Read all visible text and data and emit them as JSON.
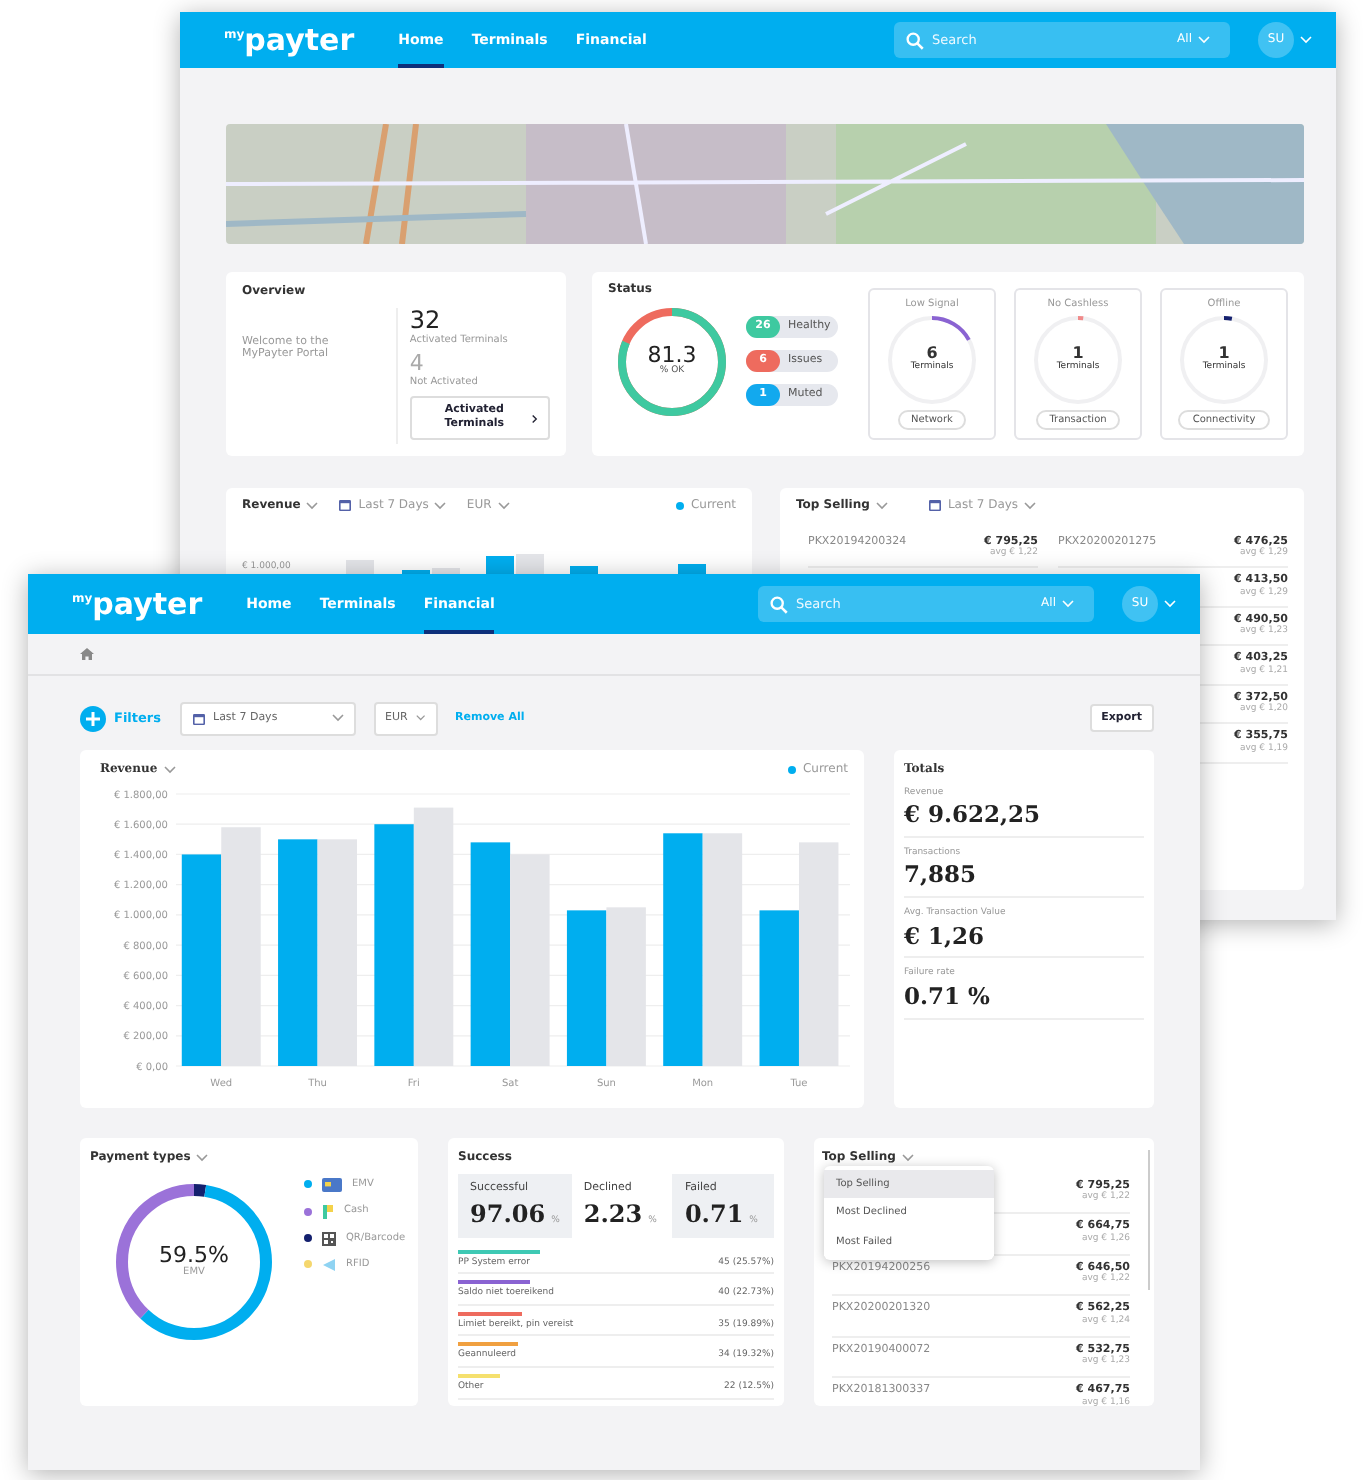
{
  "back_window": {
    "navbar": {
      "logo": "$^{my}$payter",
      "tabs": [
        {
          "label": "Home",
          "selected": true
        },
        {
          "label": "Terminals",
          "selected": false
        },
        {
          "label": "Financial",
          "selected": false
        }
      ],
      "search": {
        "placeholder": "Search"
      },
      "scope": "All",
      "avatar": "SU"
    },
    "overview": {
      "title": "Overview",
      "welcome": "Welcome to the MyPayter Portal",
      "activated_count": "32",
      "activated_label": "Activated Terminals",
      "not_activated_count": "4",
      "not_activated_label": "Not Activated",
      "button": "Activated Terminals"
    },
    "status": {
      "title": "Status",
      "gauge": {
        "value": "81.3",
        "unit": "% OK",
        "level": 0.813
      },
      "pills": [
        {
          "count": "26",
          "label": "Healthy",
          "color": "#3ec9a0"
        },
        {
          "count": "6",
          "label": "Issues",
          "color": "#ee6b5e"
        },
        {
          "count": "1",
          "label": "Muted",
          "color": "#12a9ee"
        }
      ],
      "alerts": [
        {
          "title": "Low Signal",
          "count": "6",
          "unit": "Terminals",
          "level": 0.17,
          "color": "#8a63d2",
          "button": "Network"
        },
        {
          "title": "No Cashless",
          "count": "1",
          "unit": "Terminals",
          "level": 0.02,
          "color": "#f08a8a",
          "button": "Transaction"
        },
        {
          "title": "Offline",
          "count": "1",
          "unit": "Terminals",
          "level": 0.03,
          "color": "#14206e",
          "button": "Connectivity"
        }
      ]
    },
    "revenue": {
      "title": "Revenue",
      "period": "Last 7 Days",
      "currency": "EUR",
      "legend": "Current",
      "tick": "€ 1.000,00"
    },
    "top_selling": {
      "title": "Top Selling",
      "period": "Last 7 Days",
      "left_column": [
        {
          "id": "PKX20194200324",
          "amount": "€ 795,25",
          "avg": "avg € 1,22"
        }
      ],
      "right_column": [
        {
          "id": "PKX20200201275",
          "amount": "€ 476,25",
          "avg": "avg € 1,29"
        },
        {
          "amount": "€ 413,50",
          "avg": "avg € 1,29"
        },
        {
          "amount": "€ 490,50",
          "avg": "avg € 1,23"
        },
        {
          "amount": "€ 403,25",
          "avg": "avg € 1,21"
        },
        {
          "amount": "€ 372,50",
          "avg": "avg € 1,20"
        },
        {
          "amount": "€ 355,75",
          "avg": "avg € 1,19"
        }
      ]
    }
  },
  "front_window": {
    "navbar": {
      "logo": "$^{my}$payter",
      "tabs": [
        {
          "label": "Home",
          "selected": false
        },
        {
          "label": "Terminals",
          "selected": false
        },
        {
          "label": "Financial",
          "selected": true
        }
      ],
      "search": {
        "placeholder": "Search"
      },
      "scope": "All",
      "avatar": "SU"
    },
    "filters": {
      "label": "Filters",
      "period": "Last 7 Days",
      "currency": "EUR",
      "remove": "Remove All",
      "export": "Export"
    },
    "revenue": {
      "title": "Revenue",
      "chart_data": {
        "type": "bar",
        "grid": true,
        "categories": [
          "Wed",
          "Thu",
          "Fri",
          "Sat",
          "Sun",
          "Mon",
          "Tue"
        ],
        "series": [
          {
            "name": "Current",
            "color": "#00aeef",
            "values": [
              1400,
              1500,
              1600,
              1480,
              1030,
              1540,
              1030
            ]
          },
          {
            "color": "#e4e5e9",
            "values": [
              1580,
              1500,
              1710,
              1400,
              1050,
              1540,
              1480
            ]
          }
        ],
        "ylim": [
          0,
          1800
        ],
        "yticks": [
          {
            "value": 0,
            "label": "€ 0,00"
          },
          {
            "value": 200,
            "label": "€ 200,00"
          },
          {
            "value": 400,
            "label": "€ 400,00"
          },
          {
            "value": 600,
            "label": "€ 600,00"
          },
          {
            "value": 800,
            "label": "€ 800,00"
          },
          {
            "value": 1000,
            "label": "€ 1.000,00"
          },
          {
            "value": 1200,
            "label": "€ 1.200,00"
          },
          {
            "value": 1400,
            "label": "€ 1.400,00"
          },
          {
            "value": 1600,
            "label": "€ 1.600,00"
          },
          {
            "value": 1800,
            "label": "€ 1.800,00"
          }
        ]
      }
    },
    "totals": {
      "title": "Totals",
      "items": [
        {
          "label": "Revenue",
          "value": "€ 9.622,25"
        },
        {
          "label": "Transactions",
          "value": "7,885"
        },
        {
          "label": "Avg. Transaction Value",
          "value": "€ 1,26"
        },
        {
          "label": "Failure rate",
          "value": "0.71 %"
        }
      ]
    },
    "payment_types": {
      "title": "Payment types",
      "center_value": "59.5%",
      "center_label": "EMV",
      "legend": [
        {
          "kind": "card",
          "label": "EMV",
          "color": "#00aeef"
        },
        {
          "kind": "cash",
          "label": "Cash",
          "color": "#9b72d9"
        },
        {
          "kind": "qr",
          "label": "QR/Barcode",
          "color": "#14206e"
        },
        {
          "kind": "rfid",
          "label": "RFID",
          "color": "#f5d76e"
        }
      ]
    },
    "success": {
      "title": "Success",
      "stats": [
        {
          "label": "Successful",
          "value": "97.06",
          "unit": "%",
          "selected": false
        },
        {
          "label": "Declined",
          "value": "2.23",
          "unit": "%",
          "selected": true
        },
        {
          "label": "Failed",
          "value": "0.71",
          "unit": "%",
          "selected": false
        }
      ],
      "reasons": [
        {
          "label": "PP System error",
          "count": "45 (25.57%)",
          "color": "#3ec9b4",
          "level": 0.26
        },
        {
          "label": "Saldo niet toereikend",
          "count": "40 (22.73%)",
          "color": "#8a63d2",
          "level": 0.23
        },
        {
          "label": "Limiet bereikt, pin vereist",
          "count": "35 (19.89%)",
          "color": "#ee6b5e",
          "level": 0.2
        },
        {
          "label": "Geannuleerd",
          "count": "34 (19.32%)",
          "color": "#f0a040",
          "level": 0.19
        },
        {
          "label": "Other",
          "count": "22 (12.5%)",
          "color": "#f5e06e",
          "level": 0.13
        }
      ]
    },
    "top_selling": {
      "title": "Top Selling",
      "menu": [
        {
          "label": "Top Selling",
          "selected": true
        },
        {
          "label": "Most Declined",
          "selected": false
        },
        {
          "label": "Most Failed",
          "selected": false
        }
      ],
      "rows": [
        {
          "amount": "€ 795,25",
          "avg": "avg € 1,22"
        },
        {
          "amount": "€ 664,75",
          "avg": "avg € 1,26"
        },
        {
          "id": "PKX20194200256",
          "amount": "€ 646,50",
          "avg": "avg € 1,22"
        },
        {
          "id": "PKX20200201320",
          "amount": "€ 562,25",
          "avg": "avg € 1,24"
        },
        {
          "id": "PKX20190400072",
          "amount": "€ 532,75",
          "avg": "avg € 1,23"
        },
        {
          "id": "PKX20181300337",
          "amount": "€ 467,75",
          "avg": "avg € 1,16"
        }
      ]
    }
  }
}
